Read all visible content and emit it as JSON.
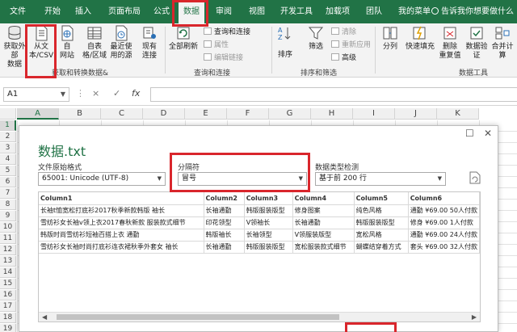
{
  "ribbon_tabs": [
    "文件",
    "开始",
    "插入",
    "页面布局",
    "公式",
    "数据",
    "审阅",
    "视图",
    "开发工具",
    "加载项",
    "团队",
    "我的菜单"
  ],
  "active_tab": "数据",
  "tell_me": "告诉我你想要做什么",
  "ribbon": {
    "get_external": {
      "label1": "获取外部",
      "label2": "数据"
    },
    "from_text": {
      "label1": "从文",
      "label2": "本/CSV"
    },
    "from_web": {
      "label1": "自",
      "label2": "网站"
    },
    "from_table": {
      "label1": "自表",
      "label2": "格/区域"
    },
    "recent_sources": {
      "label1": "最近使",
      "label2": "用的源"
    },
    "existing_conn": {
      "label1": "现有",
      "label2": "连接"
    },
    "group_get": "获取和转换数据&",
    "refresh_all": "全部刷新",
    "queries_conn": "查询和连接",
    "properties": "属性",
    "edit_links": "编辑链接",
    "group_queries": "查询和连接",
    "sort_az": "A Z",
    "sort": "排序",
    "filter": "筛选",
    "clear": "清除",
    "reapply": "重新应用",
    "advanced": "高级",
    "group_sort": "排序和筛选",
    "split": "分列",
    "flash_fill": "快速填充",
    "remove_dup": {
      "label1": "删除",
      "label2": "重复值"
    },
    "validation": {
      "label1": "数据验",
      "label2": "证"
    },
    "consolidate": {
      "label1": "合并计",
      "label2": "算"
    },
    "group_tools": "数据工具"
  },
  "formula_bar": {
    "name_box": "A1",
    "cancel": "×",
    "enter": "✓",
    "fx": "fx"
  },
  "grid": {
    "columns": [
      "A",
      "B",
      "C",
      "D",
      "E",
      "F",
      "G",
      "H",
      "I",
      "J",
      "K"
    ],
    "rows": [
      "1",
      "2",
      "3",
      "4",
      "5",
      "6",
      "7",
      "8",
      "9",
      "10",
      "11",
      "12",
      "13",
      "14",
      "15",
      "16",
      "17",
      "18",
      "19"
    ]
  },
  "dialog": {
    "title": "数据.txt",
    "origin_label": "文件原始格式",
    "origin_value": "65001: Unicode (UTF-8)",
    "delimiter_label": "分隔符",
    "delimiter_value": "冒号",
    "detect_label": "数据类型检测",
    "detect_value": "基于前 200 行",
    "columns": [
      "Column1",
      "Column2",
      "Column3",
      "Column4",
      "Column5",
      "Column6"
    ],
    "rows": [
      [
        "长袖t恤宽松打底衫2017秋季新款韩版 袖长",
        "长袖通勤",
        "韩版服装版型",
        "修身图案",
        "纯色风格",
        "通勤 ¥69.00 50人付款"
      ],
      [
        "雪纺衫女长袖v领上衣2017春秋新款 服装款式细节",
        "印花领型",
        "V领袖长",
        "长袖通勤",
        "韩版服装版型",
        "修身 ¥69.00 1人付款"
      ],
      [
        "韩版时尚雪纺衫短袖百搭上衣 通勤",
        "韩版袖长",
        "长袖领型",
        "V领服装版型",
        "宽松风格",
        "通勤 ¥69.00 24人付款"
      ],
      [
        "雪纺衫女长袖时尚打底衫连衣裙秋季外套女 袖长",
        "长袖通勤",
        "韩版服装版型",
        "宽松服装款式细节",
        "蝴蝶结穿着方式",
        "套头 ¥69.00 32人付款"
      ]
    ]
  }
}
